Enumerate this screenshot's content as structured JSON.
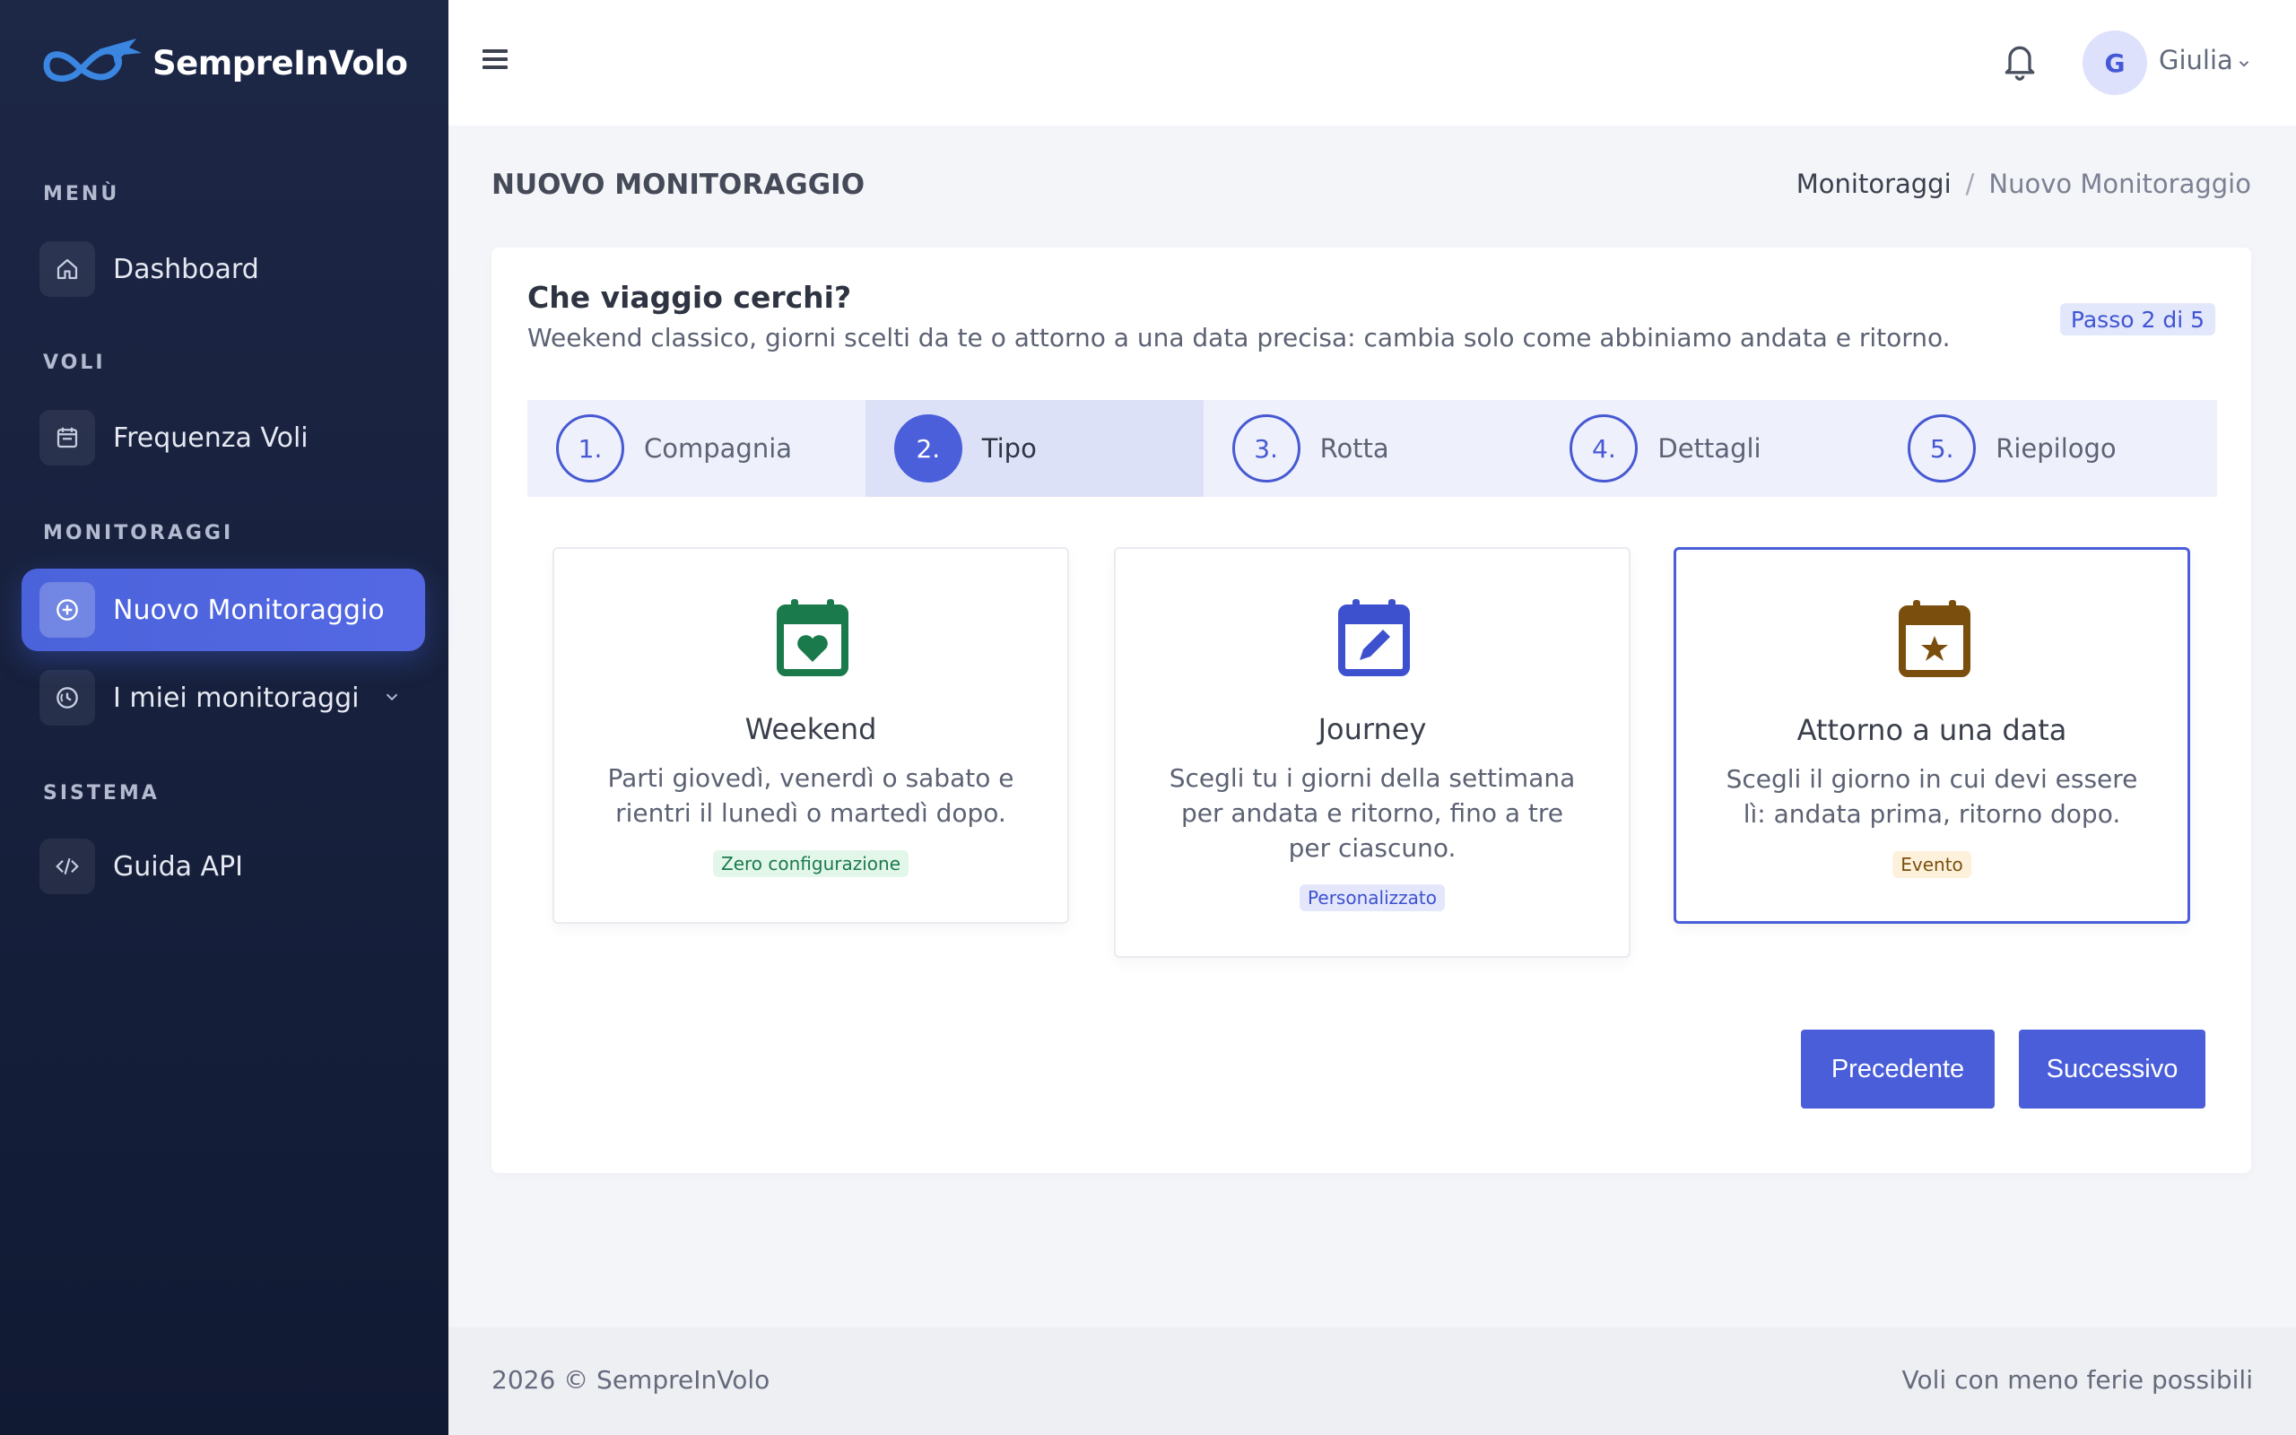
{
  "app": {
    "brand": "SempreInVolo"
  },
  "sidebar": {
    "sections": [
      {
        "label": "MENÙ"
      },
      {
        "label": "VOLI"
      },
      {
        "label": "MONITORAGGI"
      },
      {
        "label": "SISTEMA"
      }
    ],
    "items": [
      {
        "label": "Dashboard",
        "icon": "home-icon"
      },
      {
        "label": "Frequenza Voli",
        "icon": "calendar-icon"
      },
      {
        "label": "Nuovo Monitoraggio",
        "icon": "plus-circle-icon",
        "active": true
      },
      {
        "label": "I miei monitoraggi",
        "icon": "history-icon"
      },
      {
        "label": "Guida API",
        "icon": "code-icon"
      }
    ]
  },
  "topbar": {
    "avatar_initial": "G",
    "username": "Giulia"
  },
  "header": {
    "title": "NUOVO MONITORAGGIO",
    "breadcrumb": [
      "Monitoraggi",
      "Nuovo Monitoraggio"
    ],
    "breadcrumb_separator": "/"
  },
  "card": {
    "title": "Che viaggio cerchi?",
    "subtitle": "Weekend classico, giorni scelti da te o attorno a una data precisa: cambia solo come abbiniamo andata e ritorno.",
    "step_badge": "Passo 2 di 5"
  },
  "steps": [
    {
      "num": "1.",
      "label": "Compagnia"
    },
    {
      "num": "2.",
      "label": "Tipo",
      "active": true
    },
    {
      "num": "3.",
      "label": "Rotta"
    },
    {
      "num": "4.",
      "label": "Dettagli"
    },
    {
      "num": "5.",
      "label": "Riepilogo"
    }
  ],
  "options": [
    {
      "name": "Weekend",
      "description": "Parti giovedì, venerdì o sabato e rientri il lunedì o martedì dopo.",
      "tag": "Zero configurazione",
      "icon": "calendar-heart-icon",
      "color": "#1a7a4c",
      "tag_bg": "#e3f6ea"
    },
    {
      "name": "Journey",
      "description": "Scegli tu i giorni della settimana per andata e ritorno, fino a tre per ciascuno.",
      "tag": "Personalizzato",
      "icon": "calendar-edit-icon",
      "color": "#3d51cf",
      "tag_bg": "#e4e7fb"
    },
    {
      "name": "Attorno a una data",
      "description": "Scegli il giorno in cui devi essere lì: andata prima, ritorno dopo.",
      "tag": "Evento",
      "icon": "calendar-star-icon",
      "color": "#7a4f0d",
      "tag_bg": "#fdf1dc",
      "selected": true
    }
  ],
  "actions": {
    "prev": "Precedente",
    "next": "Successivo"
  },
  "footer": {
    "left": "2026 © SempreInVolo",
    "right": "Voli con meno ferie possibili"
  },
  "colors": {
    "accent": "#4a5ed9",
    "sidebar_bg": "#17213d"
  }
}
